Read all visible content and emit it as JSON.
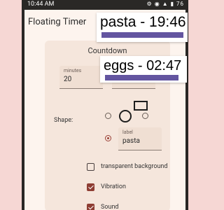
{
  "status": {
    "time": "10:44 AM",
    "icons": "⚙ ◉ ▲ ▮ 76"
  },
  "app": {
    "title": "Floating Timer"
  },
  "countdown": {
    "title": "Countdown",
    "minutes_label": "minutes",
    "minutes_value": "20"
  },
  "shape": {
    "label": "Shape:",
    "options": [
      "circle-small",
      "circle",
      "circle-small-alt",
      "rectangle",
      "text-label"
    ],
    "selected": "text-label"
  },
  "label_field": {
    "label": "label",
    "value": "pasta"
  },
  "options": {
    "transparent_label": "transparent background",
    "transparent_checked": false,
    "vibration_label": "Vibration",
    "vibration_checked": true,
    "sound_label": "Sound",
    "sound_checked": true
  },
  "floating_timers": [
    {
      "text": "pasta - 19:46",
      "progress": 0.99
    },
    {
      "text": "eggs - 02:47",
      "progress": 0.85
    }
  ],
  "colors": {
    "accent": "#8e3d33",
    "progress": "#6355a0",
    "background": "#f6d7d4"
  }
}
